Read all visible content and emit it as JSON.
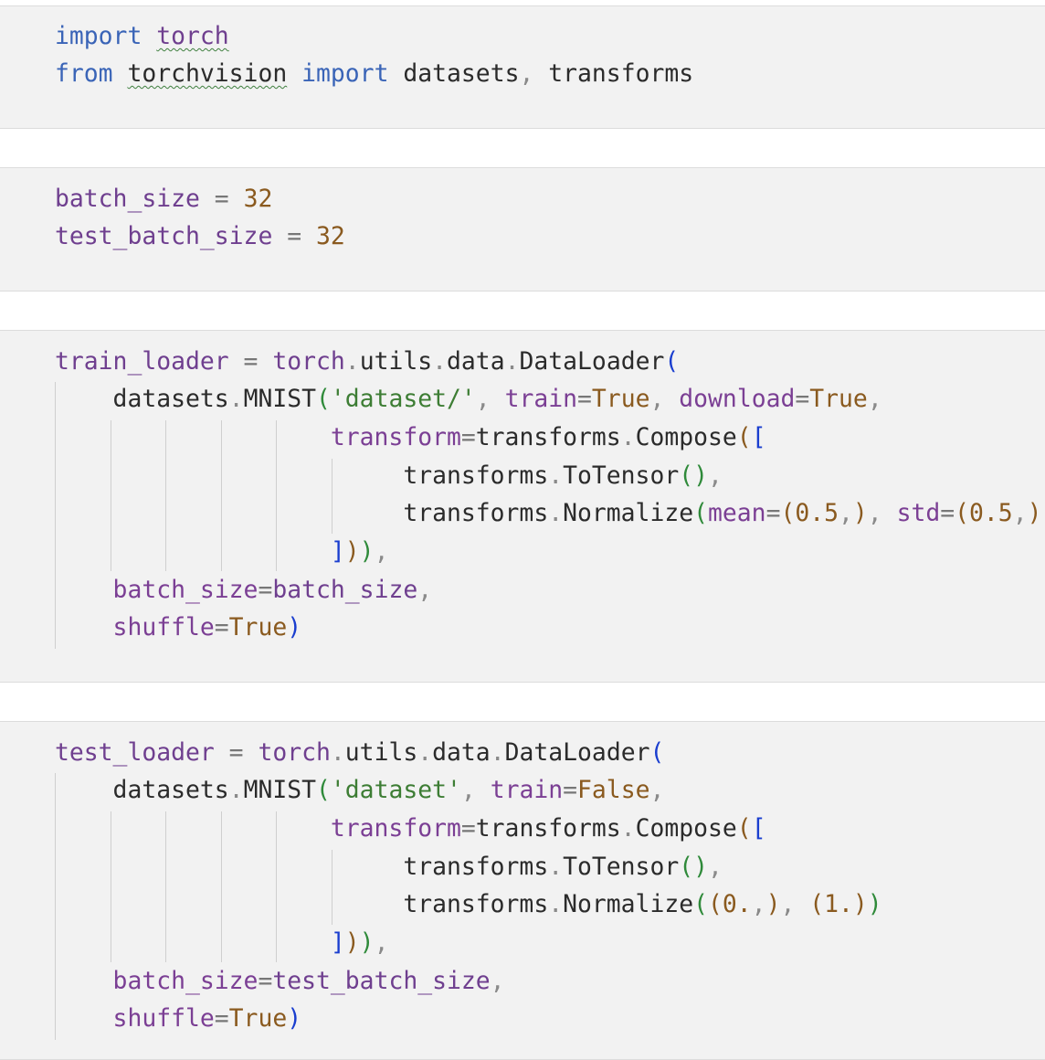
{
  "cells": [
    {
      "id": "imports",
      "lines": [
        {
          "tokens": [
            {
              "t": "import",
              "c": "kw"
            },
            {
              "t": " ",
              "c": ""
            },
            {
              "t": "torch",
              "c": "mod sq"
            }
          ]
        },
        {
          "tokens": [
            {
              "t": "from",
              "c": "kw"
            },
            {
              "t": " ",
              "c": ""
            },
            {
              "t": "torchvision",
              "c": "sq"
            },
            {
              "t": " ",
              "c": ""
            },
            {
              "t": "import",
              "c": "kw"
            },
            {
              "t": " datasets",
              "c": ""
            },
            {
              "t": ",",
              "c": "dim"
            },
            {
              "t": " transforms",
              "c": ""
            }
          ]
        }
      ]
    },
    {
      "id": "batch-sizes",
      "lines": [
        {
          "tokens": [
            {
              "t": "batch_size",
              "c": "var"
            },
            {
              "t": " = ",
              "c": "op"
            },
            {
              "t": "32",
              "c": "num"
            }
          ]
        },
        {
          "tokens": [
            {
              "t": "test_batch_size",
              "c": "var"
            },
            {
              "t": " = ",
              "c": "op"
            },
            {
              "t": "32",
              "c": "num"
            }
          ]
        }
      ]
    },
    {
      "id": "train-loader",
      "lines": [
        {
          "tokens": [
            {
              "t": "train_loader",
              "c": "var"
            },
            {
              "t": " = ",
              "c": "op"
            },
            {
              "t": "torch",
              "c": "mod"
            },
            {
              "t": ".",
              "c": "dim"
            },
            {
              "t": "utils",
              "c": ""
            },
            {
              "t": ".",
              "c": "dim"
            },
            {
              "t": "data",
              "c": ""
            },
            {
              "t": ".",
              "c": "dim"
            },
            {
              "t": "DataLoader",
              "c": ""
            },
            {
              "t": "(",
              "c": "pb"
            }
          ]
        },
        {
          "tokens": [
            {
              "t": "    datasets",
              "c": ""
            },
            {
              "t": ".",
              "c": "dim"
            },
            {
              "t": "MNIST",
              "c": ""
            },
            {
              "t": "(",
              "c": "pg"
            },
            {
              "t": "'dataset/'",
              "c": "str"
            },
            {
              "t": ", ",
              "c": "dim"
            },
            {
              "t": "train",
              "c": "arg"
            },
            {
              "t": "=",
              "c": "op"
            },
            {
              "t": "True",
              "c": "kwc"
            },
            {
              "t": ", ",
              "c": "dim"
            },
            {
              "t": "download",
              "c": "arg"
            },
            {
              "t": "=",
              "c": "op"
            },
            {
              "t": "True",
              "c": "kwc"
            },
            {
              "t": ",",
              "c": "dim"
            }
          ]
        },
        {
          "tokens": [
            {
              "t": "                   transform",
              "c": "arg"
            },
            {
              "t": "=",
              "c": "op"
            },
            {
              "t": "transforms",
              "c": ""
            },
            {
              "t": ".",
              "c": "dim"
            },
            {
              "t": "Compose",
              "c": ""
            },
            {
              "t": "(",
              "c": "pbr"
            },
            {
              "t": "[",
              "c": "pb"
            }
          ]
        },
        {
          "tokens": [
            {
              "t": "                        transforms",
              "c": ""
            },
            {
              "t": ".",
              "c": "dim"
            },
            {
              "t": "ToTensor",
              "c": ""
            },
            {
              "t": "()",
              "c": "pg"
            },
            {
              "t": ",",
              "c": "dim"
            }
          ]
        },
        {
          "tokens": [
            {
              "t": "                        transforms",
              "c": ""
            },
            {
              "t": ".",
              "c": "dim"
            },
            {
              "t": "Normalize",
              "c": ""
            },
            {
              "t": "(",
              "c": "pg"
            },
            {
              "t": "mean",
              "c": "arg"
            },
            {
              "t": "=",
              "c": "op"
            },
            {
              "t": "(",
              "c": "pbr"
            },
            {
              "t": "0.5",
              "c": "num"
            },
            {
              "t": ",",
              "c": "dim"
            },
            {
              "t": ")",
              "c": "pbr"
            },
            {
              "t": ", ",
              "c": "dim"
            },
            {
              "t": "std",
              "c": "arg"
            },
            {
              "t": "=",
              "c": "op"
            },
            {
              "t": "(",
              "c": "pbr"
            },
            {
              "t": "0.5",
              "c": "num"
            },
            {
              "t": ",",
              "c": "dim"
            },
            {
              "t": ")",
              "c": "pbr"
            },
            {
              "t": ")",
              "c": "pg"
            }
          ]
        },
        {
          "tokens": [
            {
              "t": "                   ",
              "c": ""
            },
            {
              "t": "]",
              "c": "pb"
            },
            {
              "t": ")",
              "c": "pbr"
            },
            {
              "t": ")",
              "c": "pg"
            },
            {
              "t": ",",
              "c": "dim"
            }
          ]
        },
        {
          "tokens": [
            {
              "t": "    batch_size",
              "c": "arg"
            },
            {
              "t": "=",
              "c": "op"
            },
            {
              "t": "batch_size",
              "c": "var"
            },
            {
              "t": ",",
              "c": "dim"
            }
          ]
        },
        {
          "tokens": [
            {
              "t": "    shuffle",
              "c": "arg"
            },
            {
              "t": "=",
              "c": "op"
            },
            {
              "t": "True",
              "c": "kwc"
            },
            {
              "t": ")",
              "c": "pb"
            }
          ]
        }
      ]
    },
    {
      "id": "test-loader",
      "lines": [
        {
          "tokens": [
            {
              "t": "test_loader",
              "c": "var"
            },
            {
              "t": " = ",
              "c": "op"
            },
            {
              "t": "torch",
              "c": "mod"
            },
            {
              "t": ".",
              "c": "dim"
            },
            {
              "t": "utils",
              "c": ""
            },
            {
              "t": ".",
              "c": "dim"
            },
            {
              "t": "data",
              "c": ""
            },
            {
              "t": ".",
              "c": "dim"
            },
            {
              "t": "DataLoader",
              "c": ""
            },
            {
              "t": "(",
              "c": "pb"
            }
          ]
        },
        {
          "tokens": [
            {
              "t": "    datasets",
              "c": ""
            },
            {
              "t": ".",
              "c": "dim"
            },
            {
              "t": "MNIST",
              "c": ""
            },
            {
              "t": "(",
              "c": "pg"
            },
            {
              "t": "'dataset'",
              "c": "str"
            },
            {
              "t": ", ",
              "c": "dim"
            },
            {
              "t": "train",
              "c": "arg"
            },
            {
              "t": "=",
              "c": "op"
            },
            {
              "t": "False",
              "c": "kwc"
            },
            {
              "t": ",",
              "c": "dim"
            }
          ]
        },
        {
          "tokens": [
            {
              "t": "                   transform",
              "c": "arg"
            },
            {
              "t": "=",
              "c": "op"
            },
            {
              "t": "transforms",
              "c": ""
            },
            {
              "t": ".",
              "c": "dim"
            },
            {
              "t": "Compose",
              "c": ""
            },
            {
              "t": "(",
              "c": "pbr"
            },
            {
              "t": "[",
              "c": "pb"
            }
          ]
        },
        {
          "tokens": [
            {
              "t": "                        transforms",
              "c": ""
            },
            {
              "t": ".",
              "c": "dim"
            },
            {
              "t": "ToTensor",
              "c": ""
            },
            {
              "t": "()",
              "c": "pg"
            },
            {
              "t": ",",
              "c": "dim"
            }
          ]
        },
        {
          "tokens": [
            {
              "t": "                        transforms",
              "c": ""
            },
            {
              "t": ".",
              "c": "dim"
            },
            {
              "t": "Normalize",
              "c": ""
            },
            {
              "t": "(",
              "c": "pg"
            },
            {
              "t": "(",
              "c": "pbr"
            },
            {
              "t": "0.",
              "c": "num"
            },
            {
              "t": ",",
              "c": "dim"
            },
            {
              "t": ")",
              "c": "pbr"
            },
            {
              "t": ", ",
              "c": "dim"
            },
            {
              "t": "(",
              "c": "pbr"
            },
            {
              "t": "1.",
              "c": "num"
            },
            {
              "t": ")",
              "c": "pbr"
            },
            {
              "t": ")",
              "c": "pg"
            }
          ]
        },
        {
          "tokens": [
            {
              "t": "                   ",
              "c": ""
            },
            {
              "t": "]",
              "c": "pb"
            },
            {
              "t": ")",
              "c": "pbr"
            },
            {
              "t": ")",
              "c": "pg"
            },
            {
              "t": ",",
              "c": "dim"
            }
          ]
        },
        {
          "tokens": [
            {
              "t": "    batch_size",
              "c": "arg"
            },
            {
              "t": "=",
              "c": "op"
            },
            {
              "t": "test_batch_size",
              "c": "var"
            },
            {
              "t": ",",
              "c": "dim"
            }
          ]
        },
        {
          "tokens": [
            {
              "t": "    shuffle",
              "c": "arg"
            },
            {
              "t": "=",
              "c": "op"
            },
            {
              "t": "True",
              "c": "kwc"
            },
            {
              "t": ")",
              "c": "pb"
            }
          ]
        }
      ]
    }
  ]
}
